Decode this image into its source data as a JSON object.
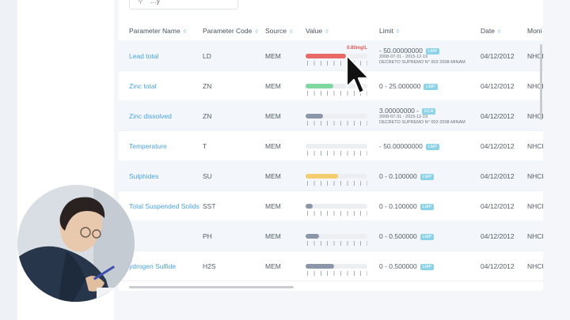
{
  "search": {
    "placeholder": "...y"
  },
  "columns": [
    {
      "label": "Parameter Name"
    },
    {
      "label": "Parameter Code"
    },
    {
      "label": "Source"
    },
    {
      "label": "Value"
    },
    {
      "label": "Limit"
    },
    {
      "label": "Date"
    },
    {
      "label": "Moni"
    }
  ],
  "rows": [
    {
      "name": "Lead total",
      "code": "LD",
      "source": "MEM",
      "fill": 0.66,
      "fill_color": "#e86a66",
      "value_label": "0.80mg/L",
      "limit": "- 50.00000000",
      "badge": "LMP",
      "range": "2008-07-31 - 2015-12-19",
      "decree": "DECRETO SUPREMO N° 002-2008-MINAM",
      "date": "04/12/2012",
      "monitor": "NHCI"
    },
    {
      "name": "Zinc total",
      "code": "ZN",
      "source": "MEM",
      "fill": 0.45,
      "fill_color": "#7ed8a0",
      "value_label": "",
      "limit": "0 - 25.000000",
      "badge": "LMP",
      "range": "",
      "decree": "",
      "date": "04/12/2012",
      "monitor": "NHCI"
    },
    {
      "name": "Zinc dissolved",
      "code": "ZN",
      "source": "MEM",
      "fill": 0.28,
      "fill_color": "#8b96a8",
      "value_label": "",
      "limit": "3.00000000 -",
      "badge": "ECA",
      "range": "2008-07-31 - 2015-12-19",
      "decree": "DECRETO SUPREMO N° 002-2008-MINAM",
      "date": "04/12/2012",
      "monitor": "NHCI"
    },
    {
      "name": "Temperature",
      "code": "T",
      "source": "MEM",
      "fill": 0.0,
      "fill_color": "#8b96a8",
      "value_label": "",
      "limit": "- 50.00000000",
      "badge": "LMP",
      "range": "",
      "decree": "",
      "date": "04/12/2012",
      "monitor": "NHCI"
    },
    {
      "name": "Sulphides",
      "code": "SU",
      "source": "MEM",
      "fill": 0.52,
      "fill_color": "#f3cd6f",
      "value_label": "",
      "limit": "0 - 0.100000",
      "badge": "LMP",
      "range": "",
      "decree": "",
      "date": "04/12/2012",
      "monitor": "NHCI"
    },
    {
      "name": "Total Suspended Solids",
      "code": "SST",
      "source": "MEM",
      "fill": 0.12,
      "fill_color": "#8b96a8",
      "value_label": "",
      "limit": "0 - 0.100000",
      "badge": "LMP",
      "range": "",
      "decree": "",
      "date": "04/12/2012",
      "monitor": "NHCI"
    },
    {
      "name": "H",
      "code": "PH",
      "source": "MEM",
      "fill": 0.22,
      "fill_color": "#8b96a8",
      "value_label": "",
      "limit": "0 - 0.500000",
      "badge": "LMP",
      "range": "",
      "decree": "",
      "date": "04/12/2012",
      "monitor": "NHCI"
    },
    {
      "name": "ydrogen Sulfide",
      "code": "H2S",
      "source": "MEM",
      "fill": 0.46,
      "fill_color": "#8b96a8",
      "value_label": "",
      "limit": "0 - 0.500000",
      "badge": "LMP",
      "range": "",
      "decree": "",
      "date": "04/12/2012",
      "monitor": "NHCI"
    }
  ]
}
